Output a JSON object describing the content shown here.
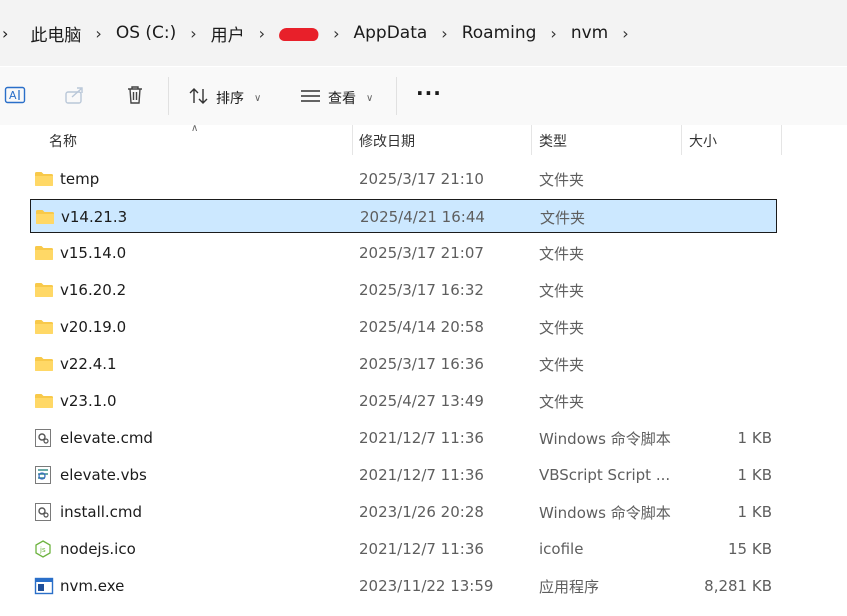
{
  "breadcrumb": {
    "items": [
      "此电脑",
      "OS (C:)",
      "",
      "AppData",
      "Roaming",
      "nvm"
    ]
  },
  "toolbar": {
    "sort_label": "排序",
    "view_label": "查看",
    "more_label": "···"
  },
  "columns": {
    "name": "名称",
    "date": "修改日期",
    "type": "类型",
    "size": "大小"
  },
  "files": [
    {
      "name": "temp",
      "date": "2025/3/17 21:10",
      "type": "文件夹",
      "size": "",
      "icon": "folder-icon"
    },
    {
      "name": "v14.21.3",
      "date": "2025/4/21 16:44",
      "type": "文件夹",
      "size": "",
      "icon": "folder-icon",
      "selected": true
    },
    {
      "name": "v15.14.0",
      "date": "2025/3/17 21:07",
      "type": "文件夹",
      "size": "",
      "icon": "folder-icon"
    },
    {
      "name": "v16.20.2",
      "date": "2025/3/17 16:32",
      "type": "文件夹",
      "size": "",
      "icon": "folder-icon"
    },
    {
      "name": "v20.19.0",
      "date": "2025/4/14 20:58",
      "type": "文件夹",
      "size": "",
      "icon": "folder-icon"
    },
    {
      "name": "v22.4.1",
      "date": "2025/3/17 16:36",
      "type": "文件夹",
      "size": "",
      "icon": "folder-icon"
    },
    {
      "name": "v23.1.0",
      "date": "2025/4/27 13:49",
      "type": "文件夹",
      "size": "",
      "icon": "folder-icon"
    },
    {
      "name": "elevate.cmd",
      "date": "2021/12/7 11:36",
      "type": "Windows 命令脚本",
      "size": "1 KB",
      "icon": "cmd-file-icon"
    },
    {
      "name": "elevate.vbs",
      "date": "2021/12/7 11:36",
      "type": "VBScript Script ...",
      "size": "1 KB",
      "icon": "vbs-file-icon"
    },
    {
      "name": "install.cmd",
      "date": "2023/1/26 20:28",
      "type": "Windows 命令脚本",
      "size": "1 KB",
      "icon": "cmd-file-icon"
    },
    {
      "name": "nodejs.ico",
      "date": "2021/12/7 11:36",
      "type": "icofile",
      "size": "15 KB",
      "icon": "nodejs-ico-icon"
    },
    {
      "name": "nvm.exe",
      "date": "2023/11/22 13:59",
      "type": "应用程序",
      "size": "8,281 KB",
      "icon": "exe-file-icon"
    }
  ],
  "colors": {
    "selection_bg": "#cce8ff",
    "folder_yellow": "#f8c94a",
    "address_bg": "#f3f3f3",
    "redaction": "#e8202a"
  }
}
